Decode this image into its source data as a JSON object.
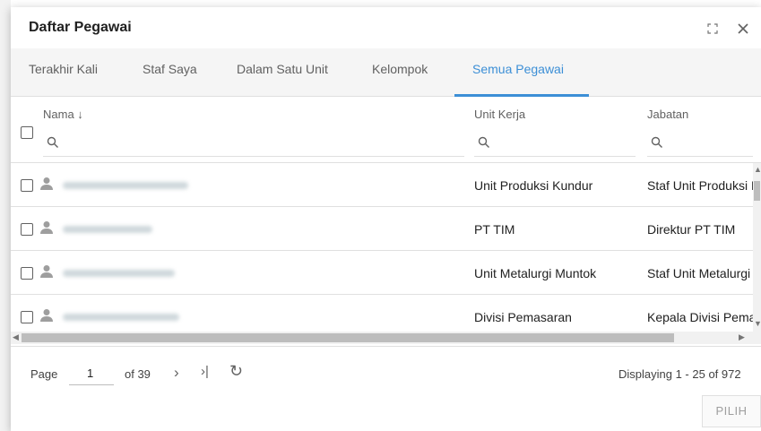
{
  "dialog": {
    "title": "Daftar Pegawai",
    "maximize_icon": "expand-icon",
    "close_icon": "close-icon"
  },
  "tabs": [
    {
      "label": "Terakhir Kali"
    },
    {
      "label": "Staf Saya"
    },
    {
      "label": "Dalam Satu Unit"
    },
    {
      "label": "Kelompok"
    },
    {
      "label": "Semua Pegawai",
      "active": true
    }
  ],
  "columns": {
    "nama": "Nama ↓",
    "unit_kerja": "Unit Kerja",
    "jabatan": "Jabatan"
  },
  "rows": [
    {
      "unit_kerja": "Unit Produksi Kundur",
      "jabatan": "Staf Unit Produksi Kundur"
    },
    {
      "unit_kerja": "PT TIM",
      "jabatan": "Direktur PT TIM"
    },
    {
      "unit_kerja": "Unit Metalurgi Muntok",
      "jabatan": "Staf Unit Metalurgi Muntok"
    },
    {
      "unit_kerja": "Divisi Pemasaran",
      "jabatan": "Kepala Divisi Pemasaran"
    }
  ],
  "pager": {
    "page_label": "Page",
    "current_page": "1",
    "of_label": "of 39",
    "next": "›",
    "last": "›|",
    "refresh": "↻",
    "displaying": "Displaying 1 - 25 of 972"
  },
  "actions": {
    "pilih": "PILIH"
  },
  "colors": {
    "accent": "#3c8fd6",
    "tab_bg": "#f5f5f5"
  }
}
